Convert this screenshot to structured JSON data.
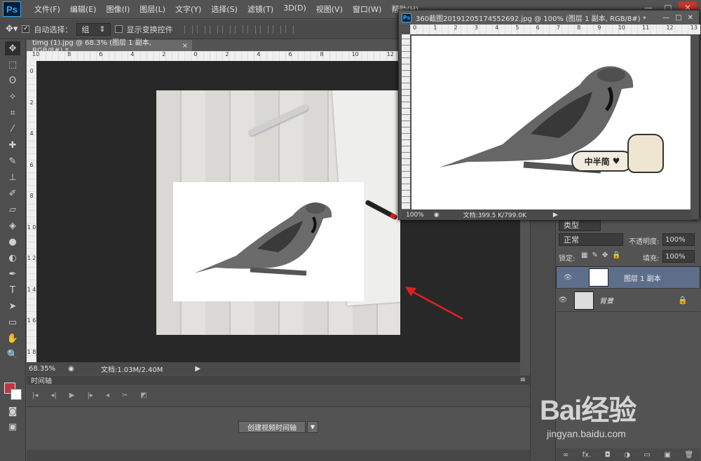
{
  "app": {
    "logo": "Ps"
  },
  "menu": [
    "文件(F)",
    "编辑(E)",
    "图像(I)",
    "图层(L)",
    "文字(Y)",
    "选择(S)",
    "滤镜(T)",
    "3D(D)",
    "视图(V)",
    "窗口(W)",
    "帮助(H)"
  ],
  "window_controls": {
    "min": "—",
    "max": "□",
    "close": "✕"
  },
  "options": {
    "auto_select_label": "自动选择：",
    "auto_select_value": "组",
    "show_transform_label": "显示变换控件"
  },
  "document": {
    "tab_title": "timg (1).jpg @ 68.3% (图层 1 副本, RGB/8#) *",
    "tab_close": "×",
    "zoom": "68.35%",
    "doc_info": "文档:1.03M/2.40M"
  },
  "ruler_h": [
    "10",
    "8",
    "6",
    "4",
    "2",
    "0",
    "2",
    "4",
    "6",
    "8",
    "10",
    "12"
  ],
  "ruler_v": [
    "0",
    "2",
    "4",
    "6",
    "8",
    "1 0",
    "1 2",
    "1 4",
    "1 6",
    "1 8"
  ],
  "float_window": {
    "title": "360截图20191205174552692.jpg @ 100% (图层 1 副本, RGB/8#) *",
    "zoom": "100%",
    "doc_info": "文档:399.5 K/799.0K",
    "ruler_h": [
      "0",
      "1",
      "2",
      "3",
      "4",
      "5",
      "6",
      "7",
      "8",
      "9",
      "10",
      "11",
      "12",
      "13"
    ],
    "badge_text": "中半简"
  },
  "timeline": {
    "header": "时间轴",
    "create_button": "创建视频时间轴"
  },
  "layers": {
    "kind_select": "类型",
    "blend_mode": "正常",
    "opacity_label": "不透明度:",
    "opacity_value": "100%",
    "lock_label": "锁定:",
    "fill_label": "填充:",
    "fill_value": "100%",
    "items": [
      {
        "name": "图层 1 副本",
        "selected": true
      },
      {
        "name": "背景",
        "selected": false,
        "locked": true
      }
    ],
    "footer_icons": [
      "link-icon",
      "fx-icon",
      "mask-icon",
      "adjustment-icon",
      "group-icon",
      "new-layer-icon",
      "trash-icon"
    ],
    "footer_labels": [
      "∞",
      "fx.",
      "◘",
      "◑",
      "▭",
      "▣",
      "🗑"
    ]
  },
  "watermark": {
    "logo": "Bai经验",
    "url": "jingyan.baidu.com"
  },
  "colors": {
    "foreground": "#c2353f",
    "background": "#ffffff",
    "selection": "#5c6e8a",
    "annotation_arrow": "#e02020"
  }
}
